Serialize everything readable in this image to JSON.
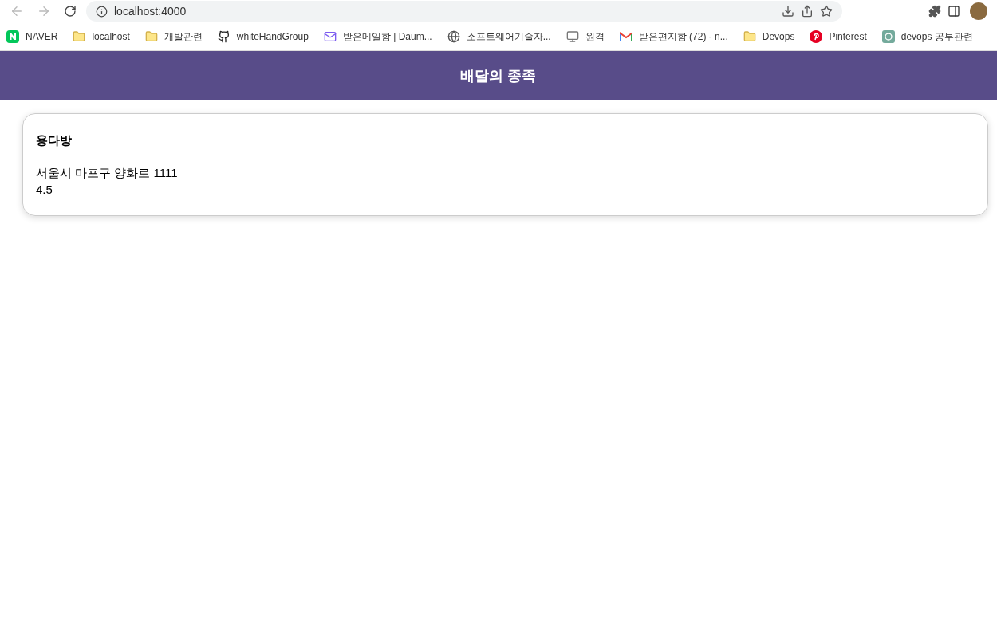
{
  "browser": {
    "url": "localhost:4000",
    "bookmarks": [
      {
        "label": "NAVER",
        "kind": "naver"
      },
      {
        "label": "localhost",
        "kind": "folder"
      },
      {
        "label": "개발관련",
        "kind": "folder"
      },
      {
        "label": "whiteHandGroup",
        "kind": "github"
      },
      {
        "label": "받은메일함 | Daum...",
        "kind": "mail"
      },
      {
        "label": "소프트웨어기술자...",
        "kind": "globe"
      },
      {
        "label": "원격",
        "kind": "remote"
      },
      {
        "label": "받은편지함 (72) - n...",
        "kind": "gmail"
      },
      {
        "label": "Devops",
        "kind": "folder"
      },
      {
        "label": "Pinterest",
        "kind": "pinterest"
      },
      {
        "label": "devops 공부관련",
        "kind": "chatgpt"
      }
    ]
  },
  "header": {
    "title": "배달의 종족"
  },
  "stores": [
    {
      "name": "용다방",
      "address": "서울시 마포구 양화로 1111",
      "rating": "4.5"
    }
  ]
}
